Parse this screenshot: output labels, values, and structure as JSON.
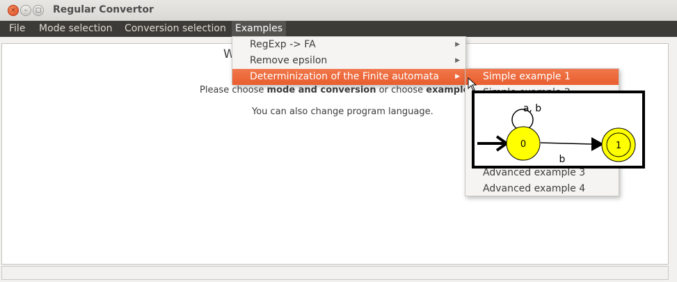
{
  "window": {
    "title": "Regular Convertor",
    "close_glyph": "×",
    "min_glyph": "–",
    "max_glyph": "□"
  },
  "menubar": {
    "items": [
      "File",
      "Mode selection",
      "Conversion selection",
      "Examples"
    ]
  },
  "content": {
    "welcome": "W",
    "line1_prefix": "Please choose ",
    "line1_bold1": "mode and conversion",
    "line1_mid": " or choose ",
    "line1_bold2": "example",
    "line2": "You can also change program language."
  },
  "examples_menu": {
    "items": [
      {
        "label": "RegExp -> FA",
        "submenu": true
      },
      {
        "label": "Remove epsilon",
        "submenu": true
      },
      {
        "label": "Determinization of the Finite automata",
        "submenu": true,
        "highlighted": true
      }
    ]
  },
  "submenu": {
    "items": [
      "Simple example 1",
      "Simple example 2",
      "Advanced example 3",
      "Advanced example 4"
    ],
    "highlighted_index": 0
  },
  "preview": {
    "state0": "0",
    "state1": "1",
    "loop_label": "a, b",
    "edge_label": "b",
    "state_fill": "#ffff00"
  },
  "colors": {
    "menubar_bg": "#3c3b37",
    "highlight": "#e95d2e"
  }
}
